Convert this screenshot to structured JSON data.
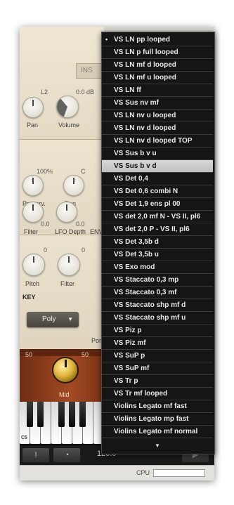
{
  "background_panel": {
    "tab_label": "INS",
    "rows": {
      "r1": {
        "value_left": "L2",
        "value_right": "0.0 dB",
        "labels": [
          "Pan",
          "Volume"
        ]
      },
      "r2": {
        "value_left": "100%",
        "value_right": "C",
        "labels": [
          "Preserv.",
          "Pan"
        ]
      },
      "r3": {
        "values": [
          "0.0",
          "0.0"
        ],
        "labels": [
          "Filter",
          "LFO Depth",
          "ENV"
        ]
      },
      "r4": {
        "values": [
          "0",
          "0"
        ],
        "labels": [
          "Pitch",
          "Filter"
        ]
      }
    },
    "key_section_label": "KEY",
    "poly_dropdown": "Poly",
    "por_label": "Por",
    "wood": {
      "values": [
        "50",
        "50"
      ],
      "knob_label": "Mid"
    },
    "keyboard_label": "C5",
    "transport": {
      "tempo": "120.0",
      "separator": "-",
      "play_icon": "play-icon"
    },
    "cpu_label": "CPU"
  },
  "preset_menu": {
    "selected_index": 0,
    "highlighted_index": 10,
    "items": [
      "VS LN pp looped",
      "VS LN p full looped",
      "VS LN mf d looped",
      "VS LN mf u looped",
      "VS LN ff",
      "VS Sus nv mf",
      "VS LN nv u looped",
      "VS LN nv d looped",
      "VS LN nv d looped TOP",
      "VS Sus b v u",
      "VS Sus b v d",
      "VS Det 0,4",
      "VS Det 0,6 combi N",
      "VS Det 1,9 ens pl 00",
      "VS det 2,0 mf N - VS II, pl6",
      "VS det 2,0 P - VS II, pl6",
      "VS Det 3,5b d",
      "VS Det 3,5b u",
      "VS Exo mod",
      "VS Staccato 0,3 mp",
      "VS Staccato 0,3 mf",
      "VS Staccato shp mf d",
      "VS Staccato shp mf u",
      "VS Piz p",
      "VS Piz mf",
      "VS SuP p",
      "VS SuP mf",
      "VS Tr p",
      "VS Tr mf looped",
      "Violins Legato mf fast",
      "Violins Legato mp fast",
      "Violins Legato mf normal"
    ],
    "more_indicator": "▼"
  }
}
